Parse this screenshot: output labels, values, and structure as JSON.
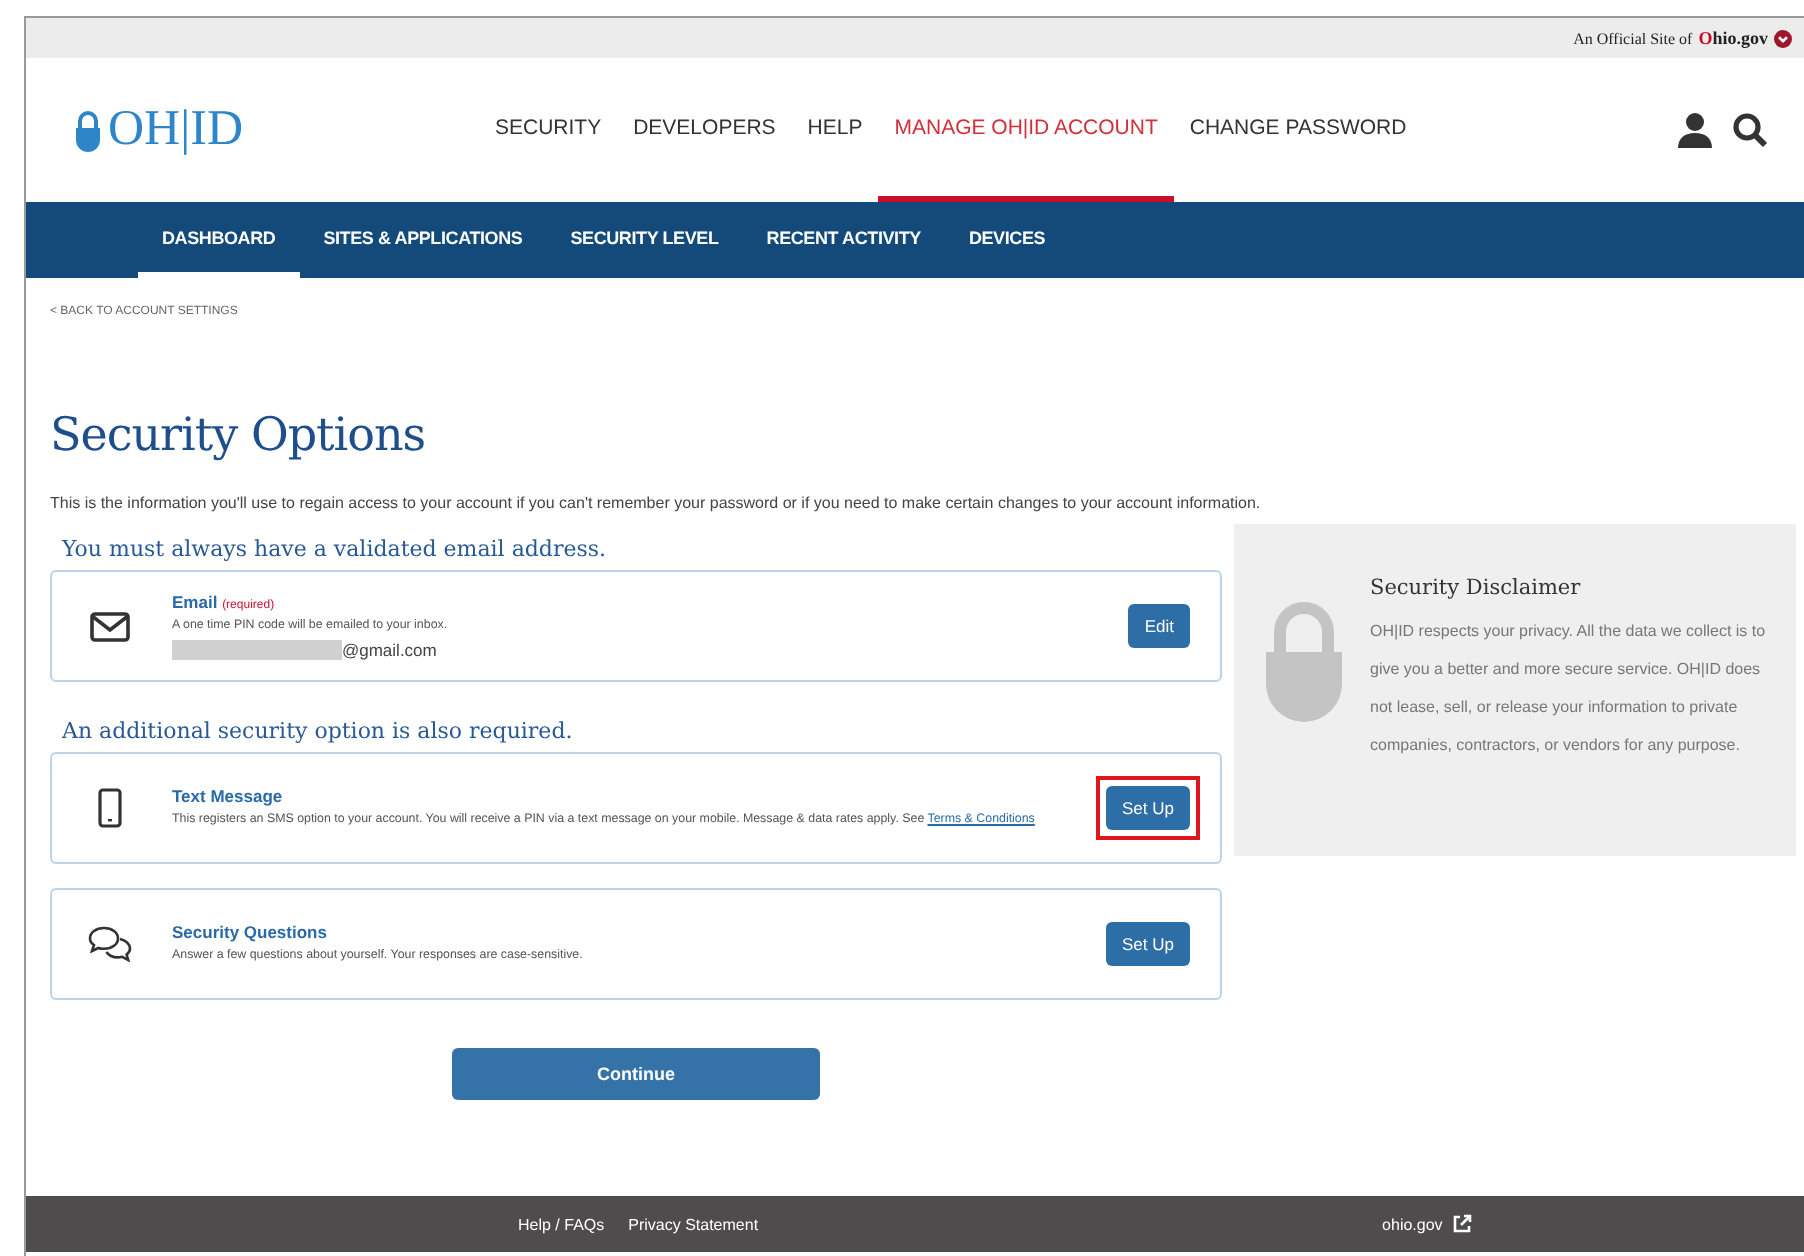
{
  "official_bar": {
    "prefix": "An Official Site of",
    "brand_first": "O",
    "brand_rest": "hio.gov"
  },
  "header": {
    "logo": "OH|ID",
    "nav": [
      {
        "label": "SECURITY",
        "selected": false
      },
      {
        "label": "DEVELOPERS",
        "selected": false
      },
      {
        "label": "HELP",
        "selected": false
      },
      {
        "label": "MANAGE OH|ID ACCOUNT",
        "selected": true
      },
      {
        "label": "CHANGE PASSWORD",
        "selected": false
      }
    ]
  },
  "subnav": [
    {
      "label": "DASHBOARD",
      "selected": true
    },
    {
      "label": "SITES & APPLICATIONS",
      "selected": false
    },
    {
      "label": "SECURITY LEVEL",
      "selected": false
    },
    {
      "label": "RECENT ACTIVITY",
      "selected": false
    },
    {
      "label": "DEVICES",
      "selected": false
    }
  ],
  "back_link": "< BACK TO ACCOUNT SETTINGS",
  "title": "Security Options",
  "intro": "This is the information you'll use to regain access to your account if you can't remember your password or if you need to make certain changes to your account information.",
  "sections": [
    {
      "heading": "You must always have a validated email address.",
      "options": [
        {
          "kind": "email",
          "title": "Email",
          "required_tag": "(required)",
          "description": "A one time PIN code will be emailed to your inbox.",
          "value": "@gmail.com",
          "redacted": true,
          "button": "Edit",
          "highlighted": false
        }
      ]
    },
    {
      "heading": "An additional security option is also required.",
      "options": [
        {
          "kind": "phone",
          "title": "Text Message",
          "description": "This registers an SMS option to your account. You will receive a PIN via a text message on your mobile. Message & data rates apply. See ",
          "link": "Terms & Conditions",
          "button": "Set Up",
          "highlighted": true
        },
        {
          "kind": "questions",
          "title": "Security Questions",
          "description": "Answer a few questions about yourself. Your responses are case-sensitive.",
          "button": "Set Up",
          "highlighted": false
        }
      ]
    }
  ],
  "continue_button": "Continue",
  "disclaimer": {
    "title": "Security Disclaimer",
    "text": "OH|ID respects your privacy. All the data we collect is to give you a better and more secure service. OH|ID does not lease, sell, or release your information to private companies, contractors, or vendors for any purpose."
  },
  "footer": {
    "links": [
      "Help / FAQs",
      "Privacy Statement"
    ],
    "site": "ohio.gov"
  }
}
